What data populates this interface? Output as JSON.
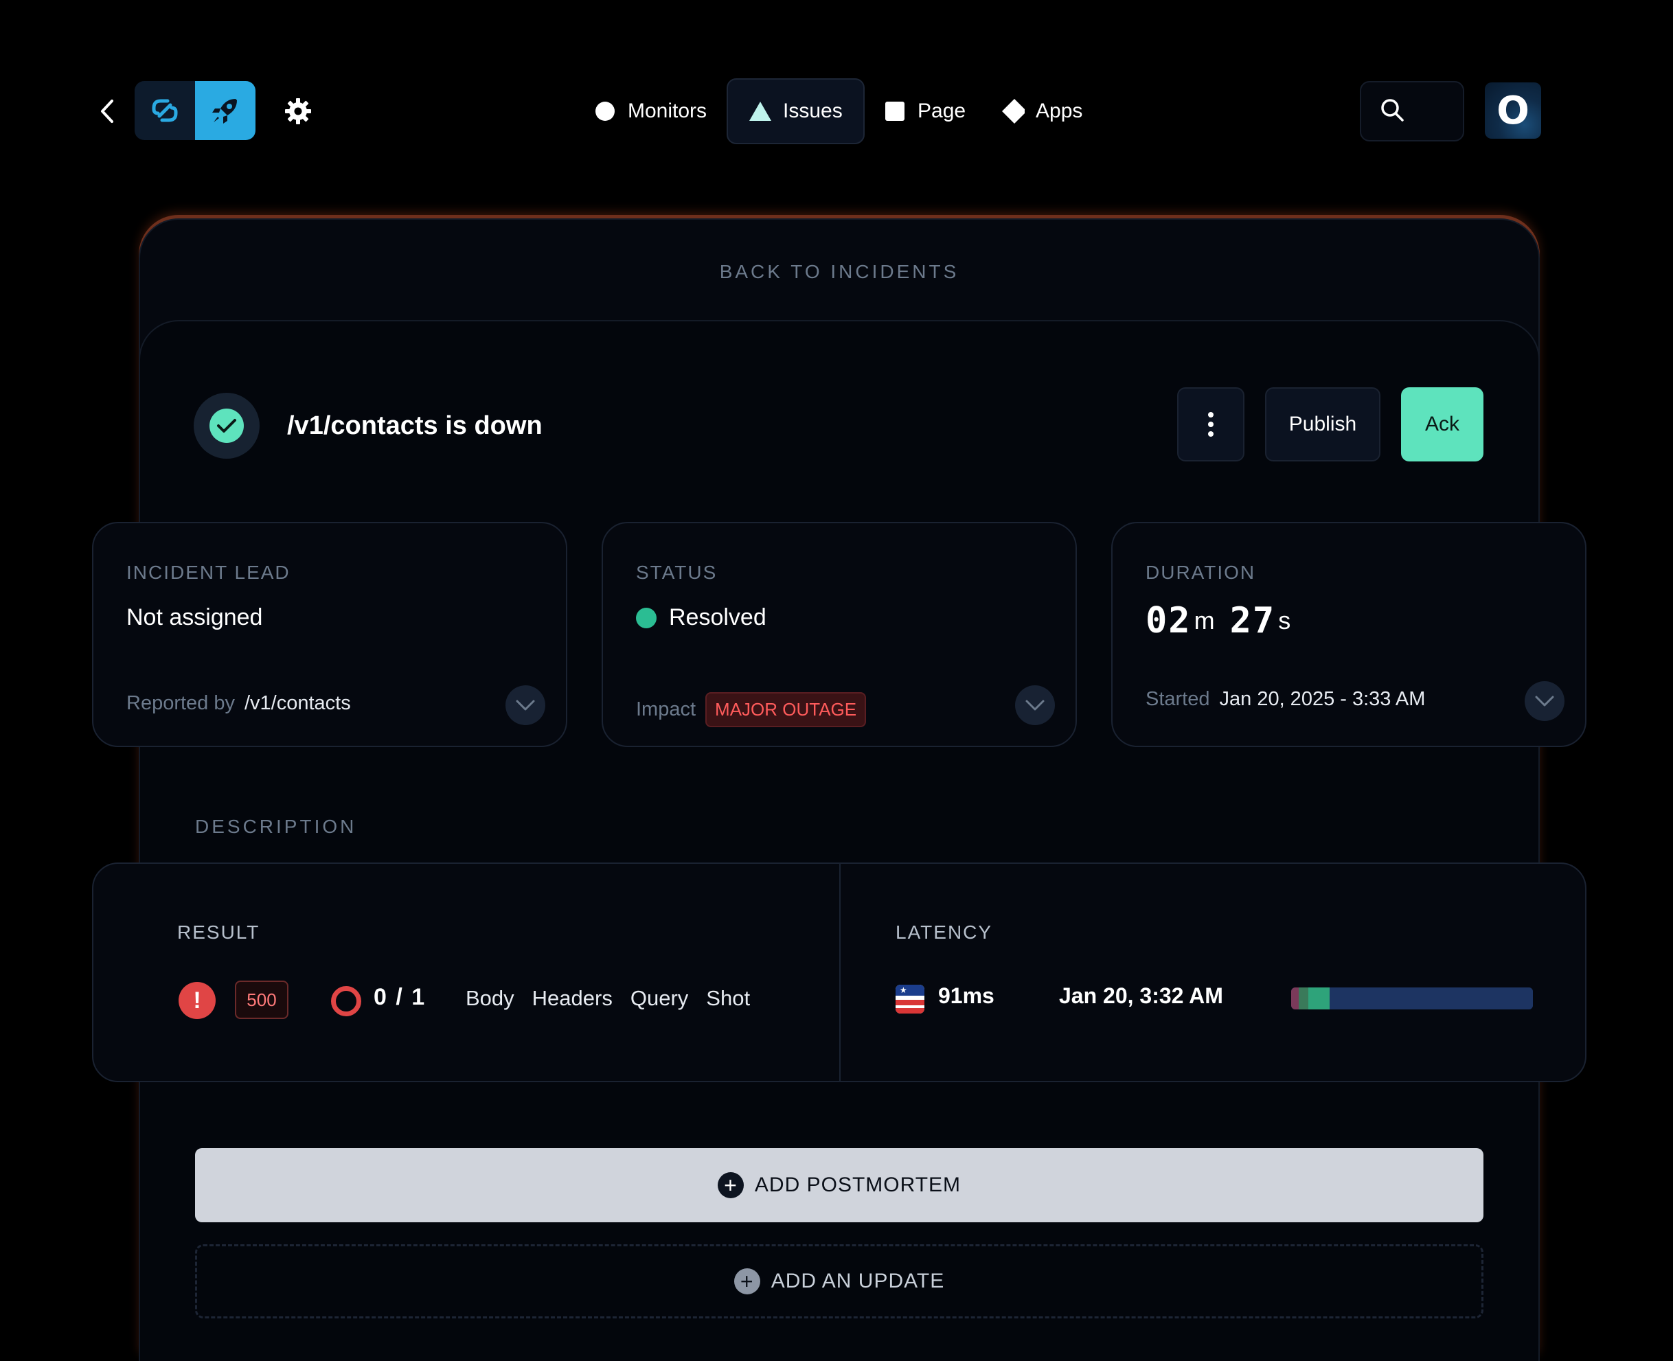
{
  "nav": {
    "items": [
      {
        "label": "Monitors",
        "icon": "circle-icon"
      },
      {
        "label": "Issues",
        "icon": "triangle-icon",
        "active": true
      },
      {
        "label": "Page",
        "icon": "square-icon"
      },
      {
        "label": "Apps",
        "icon": "diamond-icon"
      }
    ]
  },
  "avatar": {
    "initial": "O"
  },
  "incident": {
    "back_label": "BACK TO INCIDENTS",
    "title": "/v1/contacts is down",
    "publish_label": "Publish",
    "ack_label": "Ack"
  },
  "cards": {
    "lead": {
      "label": "INCIDENT LEAD",
      "value": "Not assigned",
      "foot_label": "Reported by",
      "foot_value": "/v1/contacts"
    },
    "status": {
      "label": "STATUS",
      "value": "Resolved",
      "foot_label": "Impact",
      "badge": "MAJOR OUTAGE"
    },
    "duration": {
      "label": "DURATION",
      "minutes": "02",
      "min_unit": "m",
      "seconds": "27",
      "sec_unit": "s",
      "foot_label": "Started",
      "foot_value": "Jan 20, 2025 - 3:33 AM"
    }
  },
  "description": {
    "label": "DESCRIPTION"
  },
  "result": {
    "label": "RESULT",
    "status_code": "500",
    "ratio": "0 / 1",
    "tabs": [
      "Body",
      "Headers",
      "Query",
      "Shot"
    ]
  },
  "latency": {
    "label": "LATENCY",
    "value": "91ms",
    "time": "Jan 20, 3:32 AM",
    "bar_segments": [
      {
        "fraction": 0.03,
        "color": "#7a3a5a"
      },
      {
        "fraction": 0.04,
        "color": "#3a7a5a"
      },
      {
        "fraction": 0.09,
        "color": "#2ea37a"
      },
      {
        "fraction": 0.84,
        "color": "#1d3462"
      }
    ]
  },
  "actions": {
    "postmortem_label": "ADD POSTMORTEM",
    "update_label": "ADD AN UPDATE"
  },
  "colors": {
    "accent": "#5ee3bd",
    "danger": "#e04545",
    "brand": "#2aaae2"
  }
}
